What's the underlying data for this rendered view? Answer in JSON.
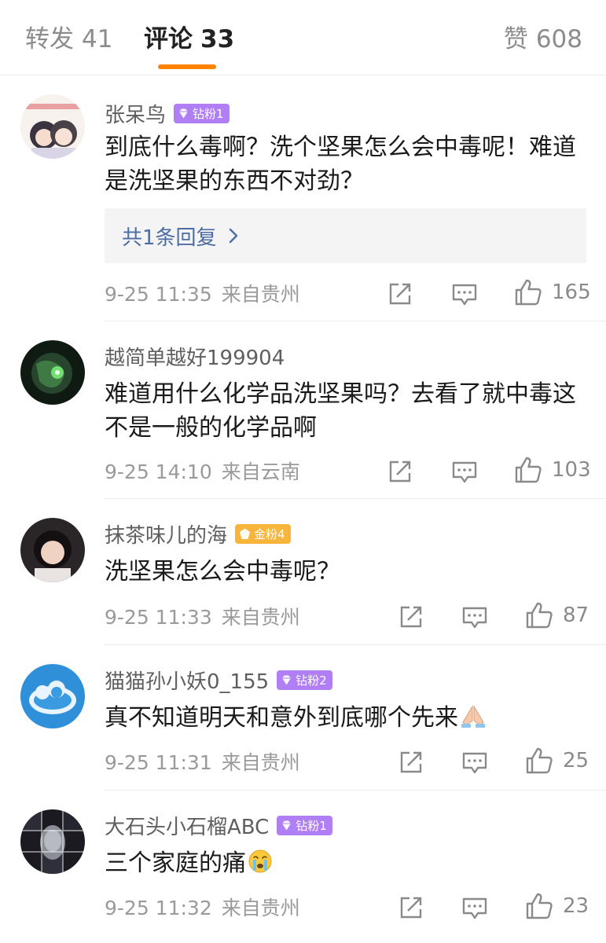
{
  "tabs": {
    "reposts": {
      "label": "转发",
      "count": "41"
    },
    "comments": {
      "label": "评论",
      "count": "33"
    },
    "likes": {
      "label": "赞",
      "count": "608"
    }
  },
  "colors": {
    "accent": "#ff8200",
    "link": "#4d6da3",
    "diamond_badge": "#b07ef5",
    "gold_badge": "#f7b53c"
  },
  "comments": [
    {
      "username": "张呆鸟",
      "badge": {
        "label": "钻粉1",
        "type": "diamond"
      },
      "text": "到底什么毒啊？洗个坚果怎么会中毒呢！难道是洗坚果的东西不对劲？",
      "reply_link": "共1条回复",
      "time": "9-25 11:35",
      "location": "来自贵州",
      "likes": "165"
    },
    {
      "username": "越简单越好199904",
      "text": "难道用什么化学品洗坚果吗？去看了就中毒这不是一般的化学品啊",
      "time": "9-25 14:10",
      "location": "来自云南",
      "likes": "103"
    },
    {
      "username": "抹茶味儿的海",
      "badge": {
        "label": "金粉4",
        "type": "gold"
      },
      "text": "洗坚果怎么会中毒呢？",
      "time": "9-25 11:33",
      "location": "来自贵州",
      "likes": "87"
    },
    {
      "username": "猫猫孙小妖0_155",
      "badge": {
        "label": "钻粉2",
        "type": "diamond"
      },
      "text": "真不知道明天和意外到底哪个先来",
      "emoji": "praying-hands-icon",
      "time": "9-25 11:31",
      "location": "来自贵州",
      "likes": "25"
    },
    {
      "username": "大石头小石榴ABC",
      "badge": {
        "label": "钻粉1",
        "type": "diamond"
      },
      "text": "三个家庭的痛",
      "emoji": "crying-face-icon",
      "time": "9-25 11:32",
      "location": "来自贵州",
      "likes": "23"
    }
  ]
}
